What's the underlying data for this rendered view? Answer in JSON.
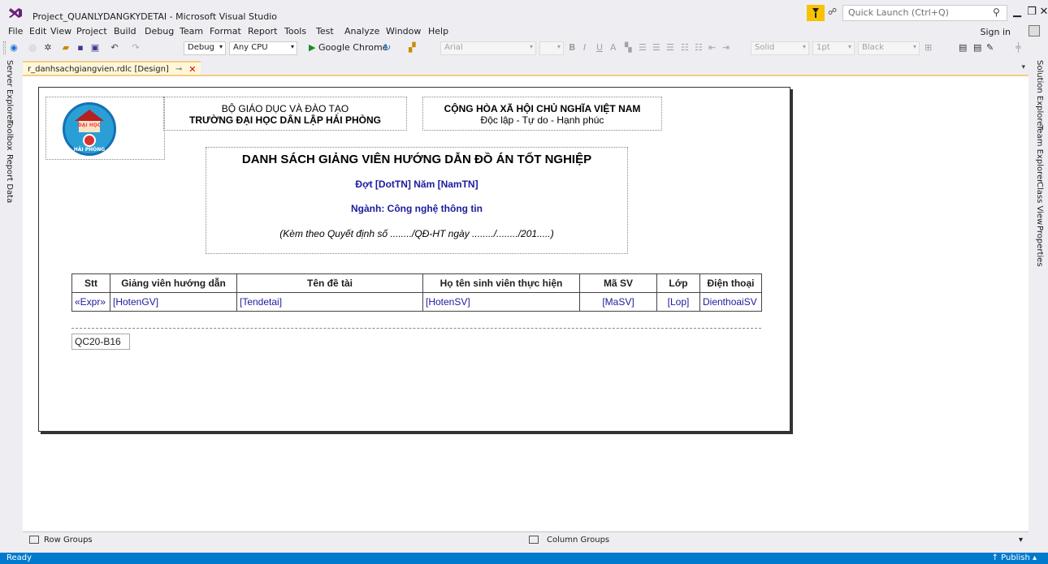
{
  "window": {
    "title": "Project_QUANLYDANGKYDETAI - Microsoft Visual Studio",
    "quick_launch_placeholder": "Quick Launch (Ctrl+Q)",
    "sign_in": "Sign in"
  },
  "menu": [
    "File",
    "Edit",
    "View",
    "Project",
    "Build",
    "Debug",
    "Team",
    "Format",
    "Report",
    "Tools",
    "Test",
    "Analyze",
    "Window",
    "Help"
  ],
  "toolbar": {
    "config": "Debug",
    "platform": "Any CPU",
    "run_target": "Google Chrome",
    "font": "Arial",
    "border_style": "Solid",
    "border_width": "1pt",
    "color": "Black"
  },
  "left_tabs": [
    "Server Explorer",
    "Toolbox",
    "Report Data"
  ],
  "right_tabs": [
    "Solution Explorer",
    "Team Explorer",
    "Class View",
    "Properties"
  ],
  "doc_tab": {
    "label": "r_danhsachgiangvien.rdlc [Design]"
  },
  "report": {
    "ministry": "BỘ GIÁO DỤC VÀ ĐÀO TẠO",
    "school": "TRƯỜNG ĐẠI HỌC DÂN LẬP HẢI PHÒNG",
    "republic": "CỘNG HÒA XÃ HỘI CHỦ NGHĨA VIỆT NAM",
    "motto": "Độc lập - Tự do - Hạnh phúc",
    "heading": "DANH SÁCH GIẢNG VIÊN HƯỚNG DẪN ĐỒ ÁN TỐT NGHIỆP",
    "batch": "Đợt [DotTN] Năm [NamTN]",
    "major": "Ngành: Công nghệ thông tin",
    "decision": "(Kèm theo Quyết định số ......../QĐ-HT ngày ......../......../201.....)",
    "logo_text_top": "ĐẠI HỌC",
    "logo_text_bottom": "HẢI PHÒNG",
    "table": {
      "headers": [
        "Stt",
        "Giảng viên hướng dẫn",
        "Tên đề tài",
        "Họ tên sinh viên thực hiện",
        "Mã SV",
        "Lớp",
        "Điện thoại"
      ],
      "row": [
        "«Expr»",
        "[HotenGV]",
        "[Tendetai]",
        "[HotenSV]",
        "[MaSV]",
        "[Lop]",
        "DienthoaiSV"
      ]
    },
    "footer_code": "QC20-B16"
  },
  "grouping": {
    "row_groups": "Row Groups",
    "column_groups": "Column Groups"
  },
  "status": {
    "left": "Ready",
    "right": "Publish"
  },
  "colors": {
    "accent": "#007acc",
    "tab_highlight": "#f5cc84",
    "field_blue": "#1b1b9e"
  }
}
